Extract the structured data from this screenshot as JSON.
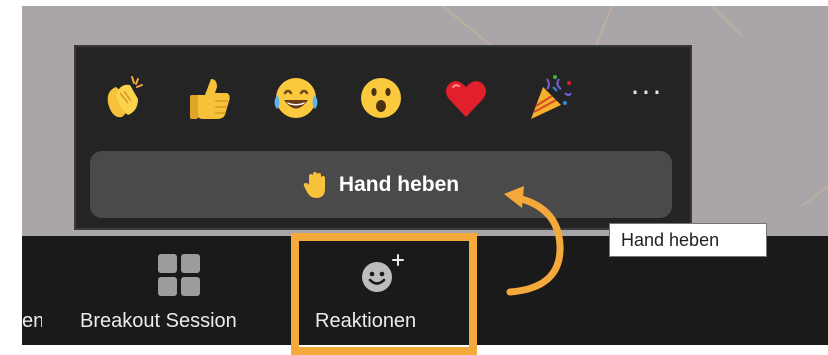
{
  "toolbar": {
    "items": [
      {
        "label": "en",
        "icon": "cropped"
      },
      {
        "label": "Breakout Session",
        "icon": "grid-icon"
      },
      {
        "label": "Reaktionen",
        "icon": "add-reaction-icon"
      }
    ]
  },
  "reactions_popup": {
    "emojis": [
      {
        "name": "clapping-hands",
        "glyph": "👏"
      },
      {
        "name": "thumbs-up",
        "glyph": "👍"
      },
      {
        "name": "tears-of-joy",
        "glyph": "😂"
      },
      {
        "name": "open-mouth",
        "glyph": "😮"
      },
      {
        "name": "red-heart",
        "glyph": "❤"
      },
      {
        "name": "party-popper",
        "glyph": "🎉"
      }
    ],
    "more": "···",
    "raise_hand_label": "Hand heben"
  },
  "tooltip": {
    "text": "Hand heben"
  },
  "colors": {
    "highlight": "#f5a93b",
    "toolbar_bg": "#1a1a1a",
    "popup_bg": "#242424",
    "button_bg": "#4a4a4a",
    "meeting_bg": "#a9a5a8"
  }
}
